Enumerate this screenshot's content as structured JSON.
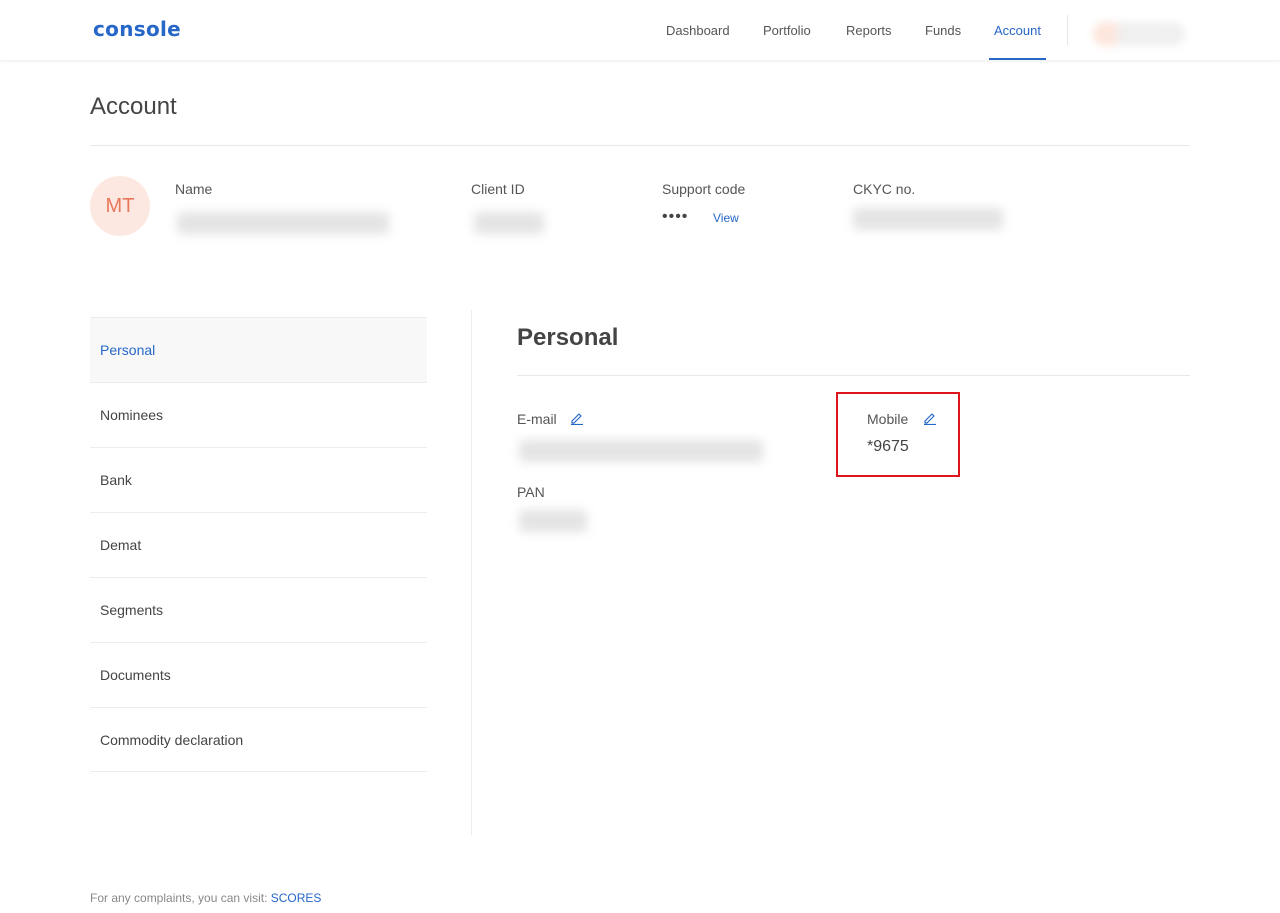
{
  "app": {
    "logo_text": "console",
    "brand_color": "#2667c8"
  },
  "nav": {
    "items": [
      {
        "label": "Dashboard"
      },
      {
        "label": "Portfolio"
      },
      {
        "label": "Reports"
      },
      {
        "label": "Funds"
      },
      {
        "label": "Account",
        "active": true
      }
    ]
  },
  "page": {
    "title": "Account"
  },
  "profile": {
    "avatar_initials": "MT",
    "name_label": "Name",
    "client_id_label": "Client ID",
    "support_code_label": "Support code",
    "support_code_masked": "••••",
    "view_label": "View",
    "ckyc_label": "CKYC no."
  },
  "side_menu": {
    "items": [
      {
        "label": "Personal",
        "active": true
      },
      {
        "label": "Nominees"
      },
      {
        "label": "Bank"
      },
      {
        "label": "Demat"
      },
      {
        "label": "Segments"
      },
      {
        "label": "Documents"
      },
      {
        "label": "Commodity declaration"
      }
    ]
  },
  "personal": {
    "title": "Personal",
    "email_label": "E-mail",
    "mobile_label": "Mobile",
    "mobile_value": "*9675",
    "pan_label": "PAN"
  },
  "footer": {
    "text": "For any complaints, you can visit: ",
    "link_label": "SCORES"
  },
  "highlight_color": "#e0141b"
}
